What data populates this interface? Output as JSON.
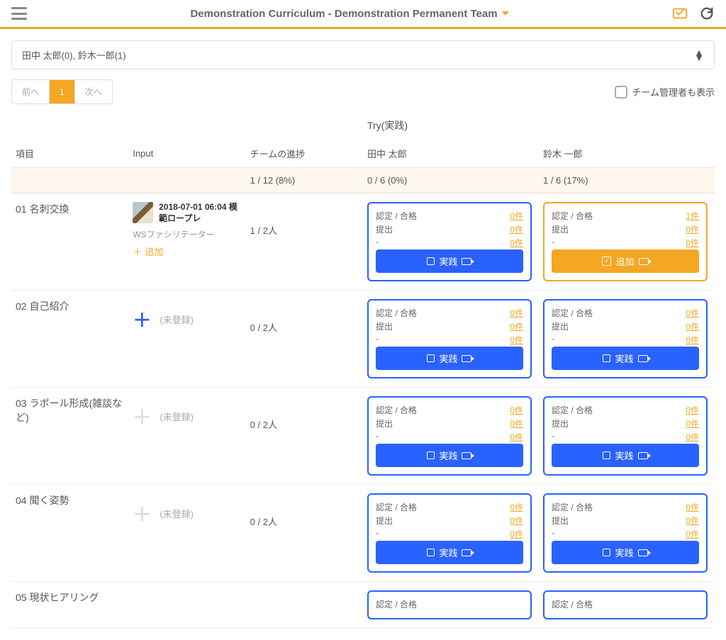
{
  "header": {
    "title": "Demonstration Curriculum - Demonstration Permanent Team"
  },
  "filter": {
    "selected": "田中 太郎(0), 鈴木一郎(1)"
  },
  "pager": {
    "prev": "前へ",
    "page": "1",
    "next": "次へ"
  },
  "checkbox": {
    "label": "チーム管理者も表示"
  },
  "columns": {
    "try_heading": "Try(実践)",
    "item": "項目",
    "input": "Input",
    "progress": "チームの進捗",
    "user1": "田中 太郎",
    "user2": "鈴木 一郎"
  },
  "summary": {
    "progress": "1 / 12 (8%)",
    "user1": "0 / 6 (0%)",
    "user2": "1 / 6 (17%)"
  },
  "card_labels": {
    "cert": "認定 / 合格",
    "submit": "提出",
    "dash": "-",
    "practice": "実践",
    "add": "追加"
  },
  "input_labels": {
    "add": "追加",
    "unregistered": "(未登録)",
    "facilitator": "WSファシリテーター"
  },
  "rows": [
    {
      "id": "01",
      "label": "01 名刺交換",
      "input_type": "thumb",
      "thumb_text": "2018-07-01 06:04 模範ロープレ",
      "progress": "1 / 2人",
      "user1": {
        "cert": "0件",
        "submit": "0件",
        "other": "0件",
        "btn": "practice",
        "style": "blue"
      },
      "user2": {
        "cert": "1件",
        "submit": "0件",
        "other": "0件",
        "btn": "add",
        "style": "orange"
      }
    },
    {
      "id": "02",
      "label": "02 自己紹介",
      "input_type": "blue",
      "progress": "0 / 2人",
      "user1": {
        "cert": "0件",
        "submit": "0件",
        "other": "0件",
        "btn": "practice",
        "style": "blue"
      },
      "user2": {
        "cert": "0件",
        "submit": "0件",
        "other": "0件",
        "btn": "practice",
        "style": "blue"
      }
    },
    {
      "id": "03",
      "label": "03 ラポール形成(雑談など)",
      "input_type": "grey",
      "progress": "0 / 2人",
      "user1": {
        "cert": "0件",
        "submit": "0件",
        "other": "0件",
        "btn": "practice",
        "style": "blue"
      },
      "user2": {
        "cert": "0件",
        "submit": "0件",
        "other": "0件",
        "btn": "practice",
        "style": "blue"
      }
    },
    {
      "id": "04",
      "label": "04 聞く姿勢",
      "input_type": "grey",
      "progress": "0 / 2人",
      "user1": {
        "cert": "0件",
        "submit": "0件",
        "other": "0件",
        "btn": "practice",
        "style": "blue"
      },
      "user2": {
        "cert": "0件",
        "submit": "0件",
        "other": "0件",
        "btn": "practice",
        "style": "blue"
      }
    },
    {
      "id": "05",
      "label": "05 現状ヒアリング",
      "input_type": "none",
      "progress": "",
      "user1": {
        "cert": "",
        "submit": "",
        "other": "",
        "btn": "",
        "style": "blue",
        "partial": true
      },
      "user2": {
        "cert": "",
        "submit": "",
        "other": "",
        "btn": "",
        "style": "blue",
        "partial": true
      }
    }
  ]
}
